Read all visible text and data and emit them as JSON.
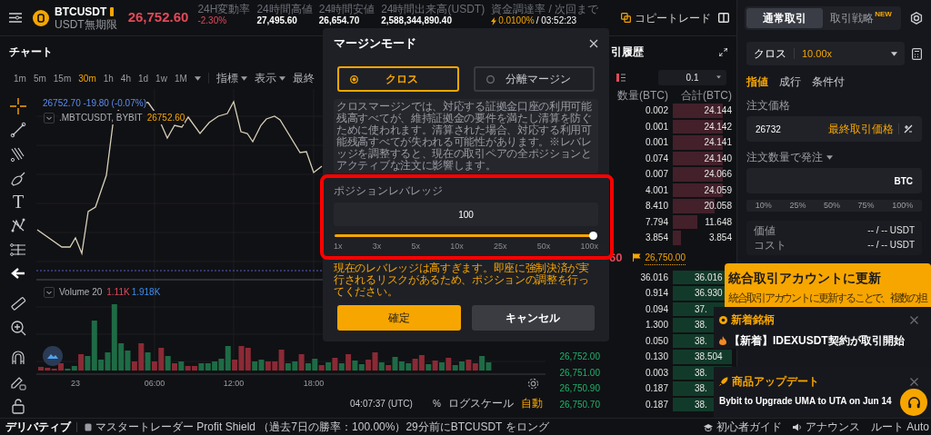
{
  "top_bar": {
    "symbol": "BTCUSDT",
    "contract_type": "USDT無期限",
    "last_price": "26,752.60",
    "stats": [
      {
        "label": "24H変動率",
        "value": "-2.30%",
        "kind": "down"
      },
      {
        "label": "24時間高値",
        "value": "27,495.60",
        "kind": "plain"
      },
      {
        "label": "24時間安値",
        "value": "26,654.70",
        "kind": "plain"
      },
      {
        "label": "24時間出来高(USDT)",
        "value": "2,588,344,890.40",
        "kind": "plain"
      },
      {
        "label": "資金調達率 / 次回まで",
        "value": "0.0100%",
        "value_2": "/ 03:52:23",
        "kind": "funding"
      }
    ],
    "copy_trade": "コピートレード"
  },
  "chart": {
    "title": "チャート",
    "intervals": [
      {
        "label": "1m",
        "selected": false
      },
      {
        "label": "5m",
        "selected": false
      },
      {
        "label": "15m",
        "selected": false
      },
      {
        "label": "30m",
        "selected": true
      },
      {
        "label": "1h",
        "selected": false
      },
      {
        "label": "4h",
        "selected": false
      },
      {
        "label": "1d",
        "selected": false
      },
      {
        "label": "1w",
        "selected": false
      },
      {
        "label": "1M",
        "selected": false
      }
    ],
    "menus": [
      "指標",
      "表示"
    ],
    "cut_menu": "最終",
    "text_tool": "T",
    "legend_change": "26752.70 -19.80 (-0.07%)",
    "series_name": ".MBTCUSDT, BYBIT",
    "series_price": "26752.60",
    "volume_label": "Volume 20",
    "volume_down": "1.11K",
    "volume_up": "1.918K",
    "time_ticks": [
      "23",
      "06:00",
      "12:00",
      "18:00"
    ],
    "clock": "04:07:37 (UTC)",
    "percent": "%",
    "log_scale": "ログスケール",
    "auto": "自動"
  },
  "order_book": {
    "title": "引履歴",
    "step": "0.1",
    "columns": [
      "数量(BTC)",
      "合計(BTC)"
    ],
    "asks": [
      {
        "qty": "0.002",
        "total": "24.144"
      },
      {
        "qty": "0.001",
        "total": "24.142"
      },
      {
        "qty": "0.001",
        "total": "24.141"
      },
      {
        "qty": "0.074",
        "total": "24.140"
      },
      {
        "qty": "0.007",
        "total": "24.066"
      },
      {
        "qty": "4.001",
        "total": "24.059"
      },
      {
        "qty": "8.410",
        "total": "20.058"
      },
      {
        "qty": "7.794",
        "total": "11.648"
      },
      {
        "qty": "3.854",
        "total": "3.854"
      }
    ],
    "mid_price": "60",
    "mark_price": "26,750.00",
    "bids": [
      {
        "qty": "36.016",
        "total": "36.016"
      },
      {
        "qty": "0.914",
        "total": "36.930"
      },
      {
        "qty": "0.094",
        "total": "37."
      },
      {
        "qty": "1.300",
        "total": "38."
      },
      {
        "qty": "0.050",
        "total": "38."
      },
      {
        "price": "26,752.00",
        "qty": "0.130",
        "total": "38.504"
      },
      {
        "price": "26,751.00",
        "qty": "0.003",
        "total": "38."
      },
      {
        "price": "26,750.90",
        "qty": "0.187",
        "total": "38."
      },
      {
        "price": "26,750.70",
        "qty": "0.187",
        "total": "38."
      }
    ]
  },
  "order_panel": {
    "tabs": [
      {
        "label": "通常取引",
        "selected": true
      },
      {
        "label": "取引戦略",
        "selected": false,
        "badge": "NEW"
      }
    ],
    "margin_mode": "クロス",
    "leverage": "10.00x",
    "order_types": [
      {
        "label": "指値",
        "selected": true
      },
      {
        "label": "成行",
        "selected": false
      },
      {
        "label": "条件付",
        "selected": false
      }
    ],
    "price_label": "注文価格",
    "price_value": "26732",
    "price_hint": "最終取引価格",
    "qty_label": "注文数量で発注",
    "qty_unit": "BTC",
    "percentages": [
      "10%",
      "25%",
      "50%",
      "75%",
      "100%"
    ],
    "summary": [
      {
        "label": "価値",
        "value": "-- / -- USDT"
      },
      {
        "label": "コスト",
        "value": "-- / -- USDT"
      }
    ]
  },
  "promo": {
    "title": "統合取引アカウントに更新",
    "body": "統合取引アカウントに更新することで、複数の担"
  },
  "notifications": [
    {
      "category": "新着銘柄",
      "message": "【新着】IDEXUSDT契約が取引開始",
      "kind": "listing"
    },
    {
      "category": "商品アップデート",
      "message": "Bybit to Upgrade UMA to UTA on Jun 14",
      "kind": "update"
    }
  ],
  "modal": {
    "title": "マージンモード",
    "modes": [
      {
        "label": "クロス",
        "selected": true
      },
      {
        "label": "分離マージン",
        "selected": false
      }
    ],
    "description": "クロスマージンでは、対応する証拠金口座の利用可能残高すべてが、維持証拠金の要件を満たし清算を防ぐために使われます。清算された場合、対応する利用可能残高すべてが失われる可能性があります。※レバレッジを調整すると、現在の取引ペアの全ポジションとアクティブな注文に影響します。",
    "leverage_label": "ポジションレバレッジ",
    "leverage_value": "100",
    "leverage": {
      "level": 1
    },
    "ticks": [
      "1x",
      "3x",
      "5x",
      "10x",
      "25x",
      "50x",
      "100x"
    ],
    "warning": "現在のレバレッジは高すぎます。即座に強制決済が実行されるリスクがあるため、ポジションの調整を行ってください。",
    "buttons": [
      {
        "label": "確定",
        "kind": "primary"
      },
      {
        "label": "キャンセル",
        "kind": "secondary"
      }
    ]
  },
  "footer": {
    "section": "デリバティブ",
    "ticker": "マスタートレーダー Profit Shield （過去7日の勝率：100.00%）29分前にBTCUSDT をロング",
    "links": [
      "初心者ガイド",
      "アナウンス",
      "ルート Auto"
    ]
  }
}
